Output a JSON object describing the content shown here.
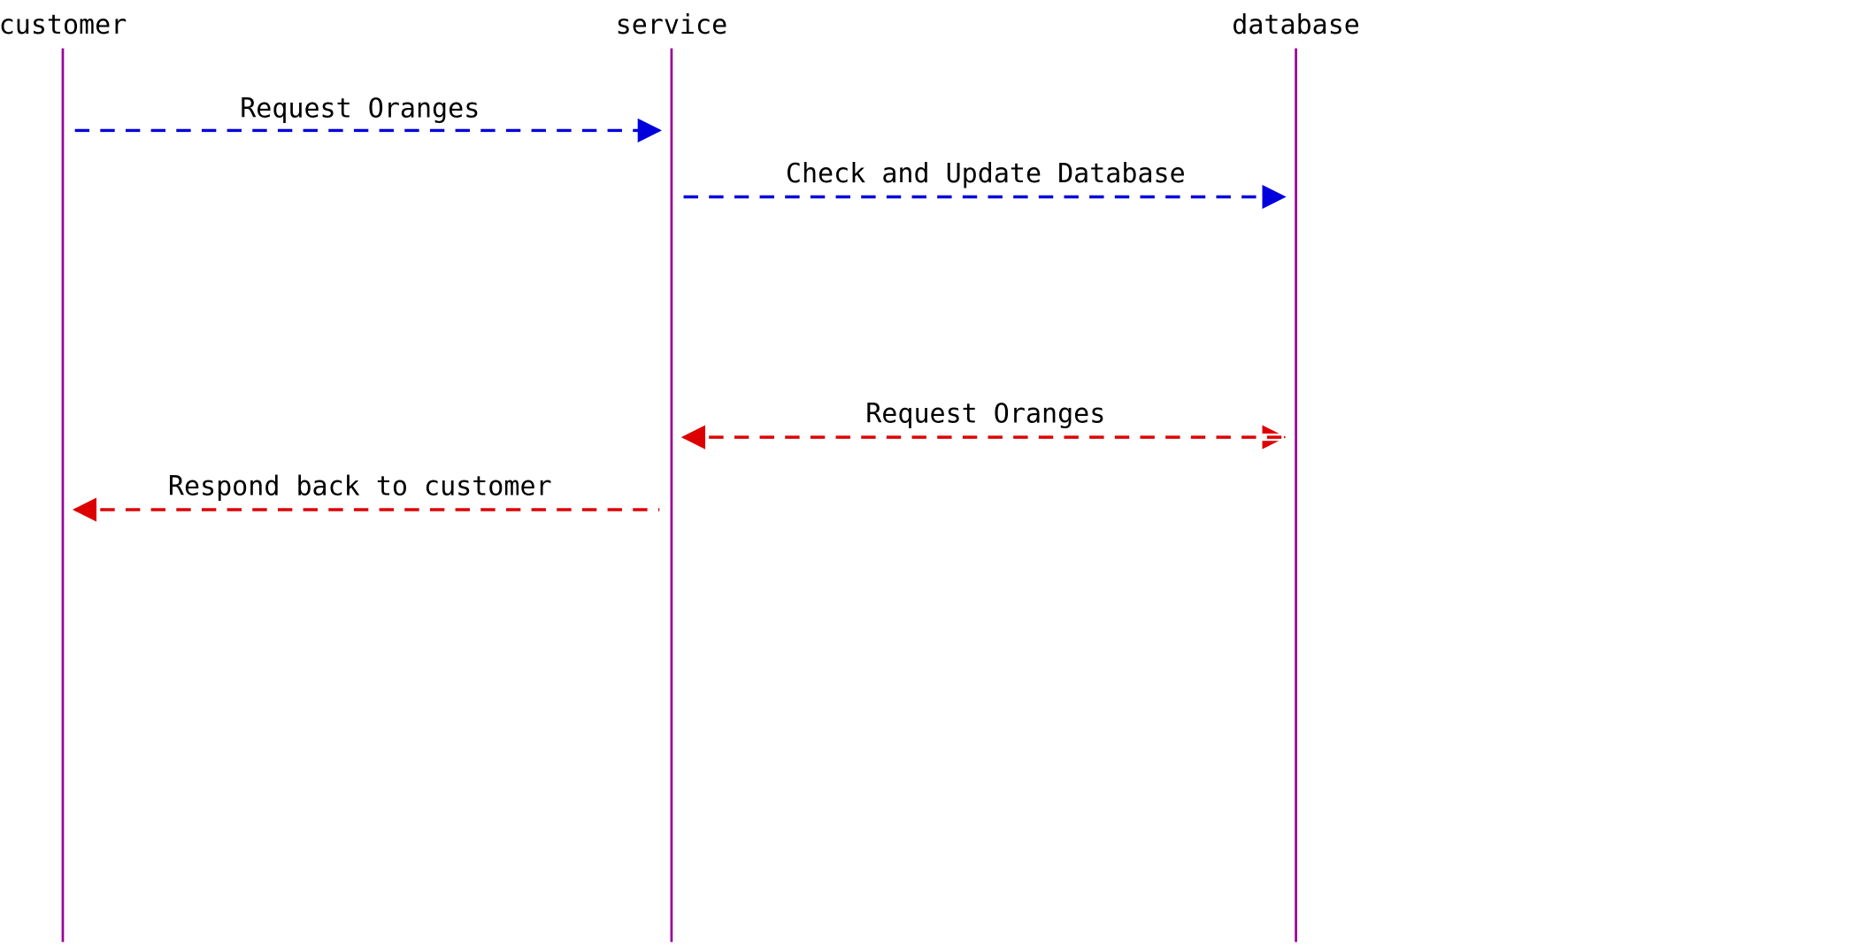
{
  "diagram": {
    "type": "sequence",
    "actors": [
      {
        "id": "customer",
        "label": "customer"
      },
      {
        "id": "service",
        "label": "service"
      },
      {
        "id": "database",
        "label": "database"
      }
    ],
    "messages": [
      {
        "from": "customer",
        "to": "service",
        "label": "Request Oranges",
        "color": "blue"
      },
      {
        "from": "service",
        "to": "database",
        "label": "Check and Update Database",
        "color": "blue"
      },
      {
        "from": "database",
        "to": "service",
        "label": "Request Oranges",
        "color": "red"
      },
      {
        "from": "service",
        "to": "customer",
        "label": "Respond back to customer",
        "color": "red"
      }
    ],
    "colors": {
      "lifeline": "#990099",
      "blue": "#0000dd",
      "red": "#dd0000",
      "text": "#000000"
    }
  }
}
